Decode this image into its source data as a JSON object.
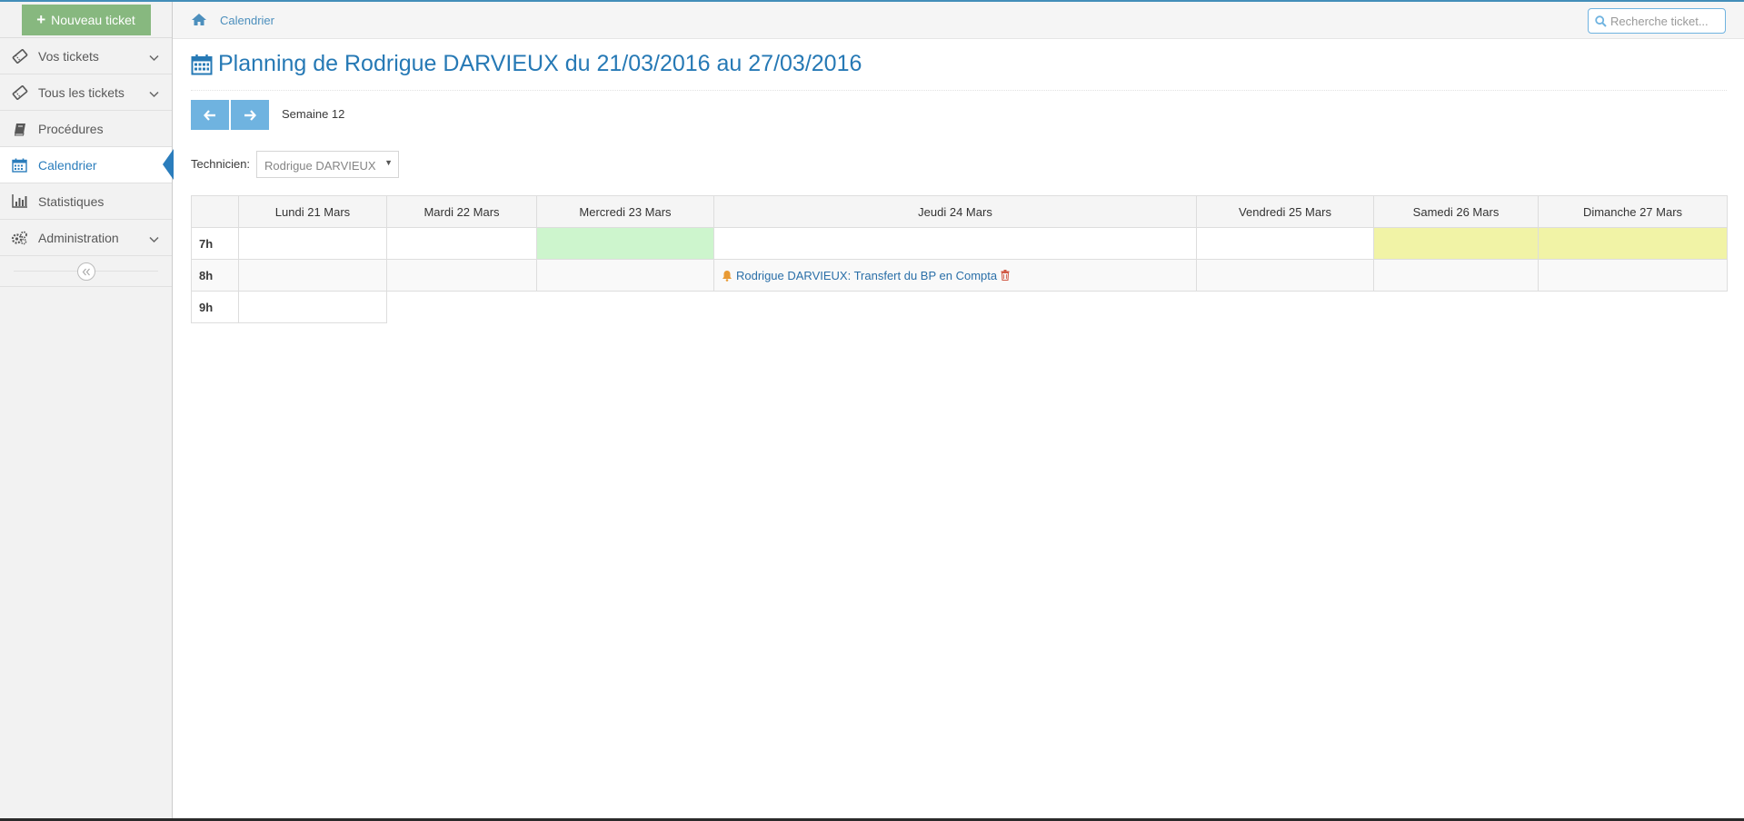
{
  "colors": {
    "accent": "#438eb9",
    "link": "#2679b5",
    "button_green": "#87b87f",
    "button_blue": "#6fb3e0",
    "cell_green": "#cdf5cd",
    "cell_yellow": "#f1f3a6",
    "bell": "#e89a34",
    "trash": "#d15b47"
  },
  "sidebar": {
    "new_ticket_label": "Nouveau ticket",
    "items": [
      {
        "label": "Vos tickets",
        "icon": "ticket-icon",
        "has_submenu": true
      },
      {
        "label": "Tous les tickets",
        "icon": "ticket-icon",
        "has_submenu": true
      },
      {
        "label": "Procédures",
        "icon": "book-icon",
        "has_submenu": false
      },
      {
        "label": "Calendrier",
        "icon": "calendar-icon",
        "has_submenu": false,
        "active": true
      },
      {
        "label": "Statistiques",
        "icon": "bar-chart-icon",
        "has_submenu": false
      },
      {
        "label": "Administration",
        "icon": "cogs-icon",
        "has_submenu": true
      }
    ],
    "collapse_icon": "double-angle-left-icon"
  },
  "breadcrumbs": {
    "home_icon": "home-icon",
    "current": "Calendrier"
  },
  "search": {
    "placeholder": "Recherche ticket..."
  },
  "page": {
    "title": "Planning de Rodrigue DARVIEUX du 21/03/2016 au 27/03/2016",
    "week_label": "Semaine 12",
    "prev_icon": "arrow-left-icon",
    "next_icon": "arrow-right-icon",
    "technician_label": "Technicien:",
    "technician_value": "Rodrigue DARVIEUX"
  },
  "calendar": {
    "days": [
      "Lundi 21 Mars",
      "Mardi 22 Mars",
      "Mercredi 23 Mars",
      "Jeudi 24 Mars",
      "Vendredi 25 Mars",
      "Samedi 26 Mars",
      "Dimanche 27 Mars"
    ],
    "hours": [
      "7h",
      "8h",
      "9h"
    ],
    "highlighted": [
      {
        "hour": "7h",
        "day": "Mercredi 23 Mars",
        "color": "green"
      },
      {
        "hour": "7h",
        "day": "Samedi 26 Mars",
        "color": "yellow"
      },
      {
        "hour": "7h",
        "day": "Dimanche 27 Mars",
        "color": "yellow"
      }
    ],
    "events": [
      {
        "hour": "8h",
        "day": "Jeudi 24 Mars",
        "text": "Rodrigue DARVIEUX: Transfert du BP en Compta",
        "icon": "bell-icon",
        "action_icon": "trash-icon"
      }
    ]
  }
}
